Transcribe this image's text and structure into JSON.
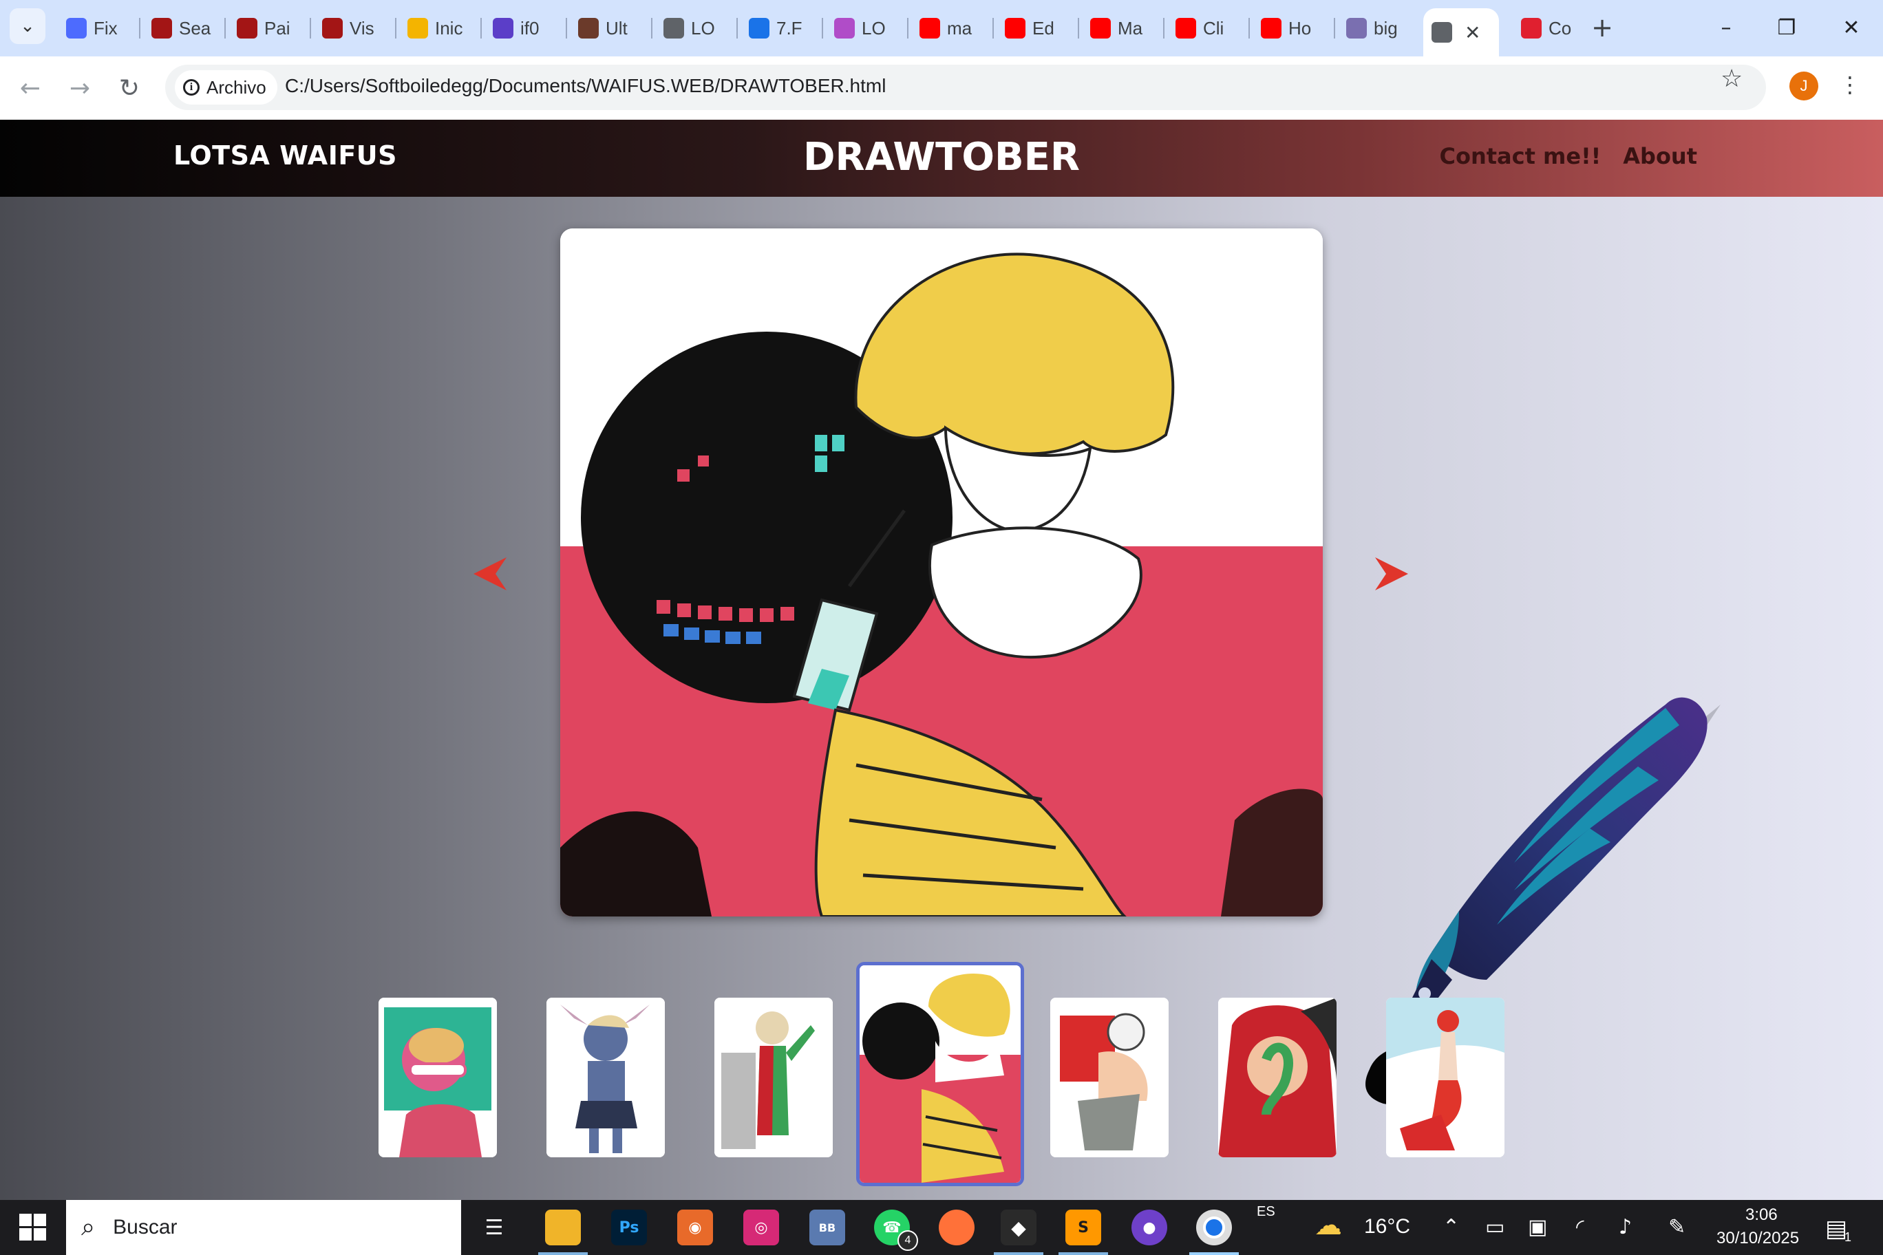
{
  "browser": {
    "tabs": [
      {
        "title": "Fix",
        "icon": "deepseek-whale-icon",
        "color": "#4d6bfe"
      },
      {
        "title": "Sea",
        "icon": "schema-org-icon",
        "color": "#a31515"
      },
      {
        "title": "Pai",
        "icon": "schema-org-icon",
        "color": "#a31515"
      },
      {
        "title": "Vis",
        "icon": "schema-org-icon",
        "color": "#a31515"
      },
      {
        "title": "Inic",
        "icon": "google-classroom-icon",
        "color": "#f4b400"
      },
      {
        "title": "if0",
        "icon": "infinity-icon",
        "color": "#5b3ec8"
      },
      {
        "title": "Ult",
        "icon": "anime-avatar-icon",
        "color": "#6b3a2a"
      },
      {
        "title": "LO",
        "icon": "globe-icon",
        "color": "#5f6368"
      },
      {
        "title": "7.F",
        "icon": "contact-card-icon",
        "color": "#1a73e8"
      },
      {
        "title": "LO",
        "icon": "character-icon",
        "color": "#b04cc8"
      },
      {
        "title": "ma",
        "icon": "youtube-icon",
        "color": "#ff0000"
      },
      {
        "title": "Ed",
        "icon": "youtube-icon",
        "color": "#ff0000"
      },
      {
        "title": "Ma",
        "icon": "youtube-icon",
        "color": "#ff0000"
      },
      {
        "title": "Cli",
        "icon": "youtube-icon",
        "color": "#ff0000"
      },
      {
        "title": "Ho",
        "icon": "youtube-icon",
        "color": "#ff0000"
      },
      {
        "title": "big",
        "icon": "ai-swirl-icon",
        "color": "#7a6fb0"
      },
      {
        "title": "",
        "icon": "globe-icon",
        "color": "#5f6368",
        "active": true
      },
      {
        "title": "Co",
        "icon": "opera-icon",
        "color": "#e0202f"
      }
    ],
    "security_chip": "Archivo",
    "url": "C:/Users/Softboiledegg/Documents/WAIFUS.WEB/DRAWTOBER.html",
    "profile_initial": "J"
  },
  "site": {
    "brand": "LOTSA WAIFUS",
    "title": "DRAWTOBER",
    "nav": [
      "Contact me!!",
      "About"
    ],
    "accent": "#e0352b",
    "selected_thumbnail_index": 3,
    "thumbnail_count": 7
  },
  "taskbar": {
    "search_placeholder": "Buscar",
    "whatsapp_badge": "4",
    "language": "ES",
    "weather": "16°C",
    "time": "3:06",
    "date": "30/10/2025",
    "notifications_badge": "1"
  }
}
